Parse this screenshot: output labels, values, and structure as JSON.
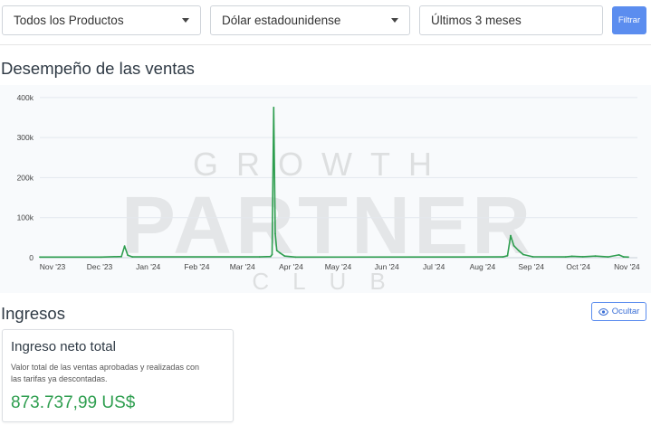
{
  "filters": {
    "product": "Todos los Productos",
    "currency": "Dólar estadounidense",
    "period": "Últimos 3 meses",
    "filter_button": "Filtrar"
  },
  "sales_section": {
    "title": "Desempeño de las ventas"
  },
  "chart_data": {
    "type": "line",
    "title": "",
    "xlabel": "",
    "ylabel": "",
    "x_tick_labels": [
      "Nov '23",
      "Dec '23",
      "Jan '24",
      "Feb '24",
      "Mar '24",
      "Apr '24",
      "May '24",
      "Jun '24",
      "Jul '24",
      "Aug '24",
      "Sep '24",
      "Oct '24",
      "Nov '24"
    ],
    "y_tick_labels": [
      "0",
      "100k",
      "200k",
      "300k",
      "400k"
    ],
    "ylim": [
      0,
      420000
    ],
    "x_range": [
      "2023-11-01",
      "2024-11-10"
    ],
    "grid": true,
    "legend": "none",
    "series": [
      {
        "color": "#2e9e4f",
        "points": [
          [
            "2023-11-01",
            1500
          ],
          [
            "2023-12-10",
            1500
          ],
          [
            "2023-12-23",
            3000
          ],
          [
            "2023-12-25",
            29000
          ],
          [
            "2023-12-27",
            6000
          ],
          [
            "2023-12-30",
            2000
          ],
          [
            "2024-03-20",
            2000
          ],
          [
            "2024-03-27",
            3000
          ],
          [
            "2024-03-28",
            8000
          ],
          [
            "2024-03-29",
            375000
          ],
          [
            "2024-03-30",
            60000
          ],
          [
            "2024-03-31",
            18000
          ],
          [
            "2024-04-02",
            12000
          ],
          [
            "2024-04-05",
            4000
          ],
          [
            "2024-04-12",
            1500
          ],
          [
            "2024-08-22",
            2000
          ],
          [
            "2024-08-25",
            5000
          ],
          [
            "2024-08-27",
            55000
          ],
          [
            "2024-08-29",
            30000
          ],
          [
            "2024-09-01",
            18000
          ],
          [
            "2024-09-04",
            8000
          ],
          [
            "2024-09-10",
            2500
          ],
          [
            "2024-10-01",
            2000
          ],
          [
            "2024-10-05",
            3500
          ],
          [
            "2024-10-12",
            2500
          ],
          [
            "2024-10-20",
            4000
          ],
          [
            "2024-10-28",
            2000
          ],
          [
            "2024-11-04",
            7000
          ],
          [
            "2024-11-07",
            2000
          ],
          [
            "2024-11-10",
            1500
          ]
        ]
      }
    ]
  },
  "watermark": {
    "top": "GROWTH",
    "middle": "PARTNER",
    "bottom": "CLUB"
  },
  "income_section": {
    "title": "Ingresos",
    "hide_button": "Ocultar",
    "card": {
      "title": "Ingreso neto total",
      "description": "Valor total de las ventas aprobadas y realizadas con las tarifas ya descontadas.",
      "value": "873.737,99 US$",
      "value_color": "#2e9e4f"
    }
  },
  "colors": {
    "accent": "#5b8def",
    "line": "#2e9e4f",
    "grid": "#e3e8ee"
  },
  "icons": {
    "hide_button_icon": "eye-icon",
    "select_caret": "caret-down-icon"
  }
}
